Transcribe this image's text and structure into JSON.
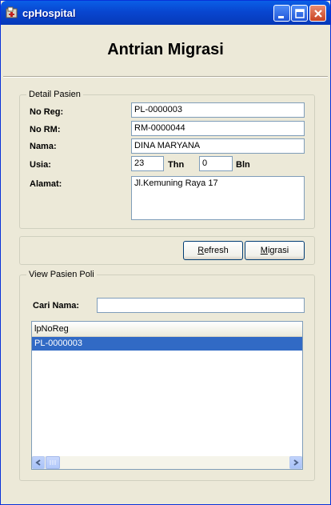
{
  "window": {
    "title": "cpHospital"
  },
  "header": {
    "title": "Antrian Migrasi"
  },
  "detail": {
    "legend": "Detail Pasien",
    "no_reg_label": "No Reg:",
    "no_reg_value": "PL-0000003",
    "no_rm_label": "No RM:",
    "no_rm_value": "RM-0000044",
    "nama_label": "Nama:",
    "nama_value": "DINA MARYANA",
    "usia_label": "Usia:",
    "usia_thn_value": "23",
    "thn_label": "Thn",
    "usia_bln_value": "0",
    "bln_label": "Bln",
    "alamat_label": "Alamat:",
    "alamat_value": "Jl.Kemuning Raya 17"
  },
  "actions": {
    "refresh_label": "efresh",
    "refresh_accel": "R",
    "migrasi_label": "igrasi",
    "migrasi_accel": "M"
  },
  "view": {
    "legend": "View Pasien Poli",
    "cari_label": "Cari Nama:",
    "cari_value": "",
    "columns": [
      "lpNoReg"
    ],
    "rows": [
      [
        "PL-0000003"
      ]
    ]
  },
  "colors": {
    "titlebar": "#0846D0",
    "selection": "#316AC5",
    "face": "#ECE9D8"
  },
  "icons": {
    "app": "hospital-app-icon",
    "minimize": "minimize-icon",
    "maximize": "maximize-icon",
    "close": "close-icon"
  }
}
